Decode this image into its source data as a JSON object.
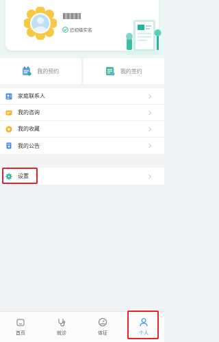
{
  "profile": {
    "verify_text": "已初级实名"
  },
  "quick_actions": [
    {
      "label": "我的预约",
      "icon": "calendar-clipboard-icon"
    },
    {
      "label": "我的签约",
      "icon": "contract-icon"
    }
  ],
  "menu": [
    {
      "label": "家庭联系人",
      "icon": "contacts-icon",
      "color": "#4a90e2"
    },
    {
      "label": "我的咨询",
      "icon": "message-icon",
      "color": "#f5b323"
    },
    {
      "label": "我的收藏",
      "icon": "star-icon",
      "color": "#f5b323"
    },
    {
      "label": "我的公告",
      "icon": "notice-icon",
      "color": "#4a90e2"
    }
  ],
  "settings": {
    "label": "设置",
    "icon": "gear-icon",
    "color": "#25b59a"
  },
  "bottom_nav": [
    {
      "label": "首页",
      "icon": "home-icon"
    },
    {
      "label": "就诊",
      "icon": "stethoscope-icon"
    },
    {
      "label": "体征",
      "icon": "gauge-icon"
    },
    {
      "label": "个人",
      "icon": "person-icon",
      "active": true
    }
  ],
  "colors": {
    "accent": "#2f9ee6",
    "highlight": "#e8202c",
    "teal": "#25b59a",
    "background": "#f2f3f5"
  }
}
